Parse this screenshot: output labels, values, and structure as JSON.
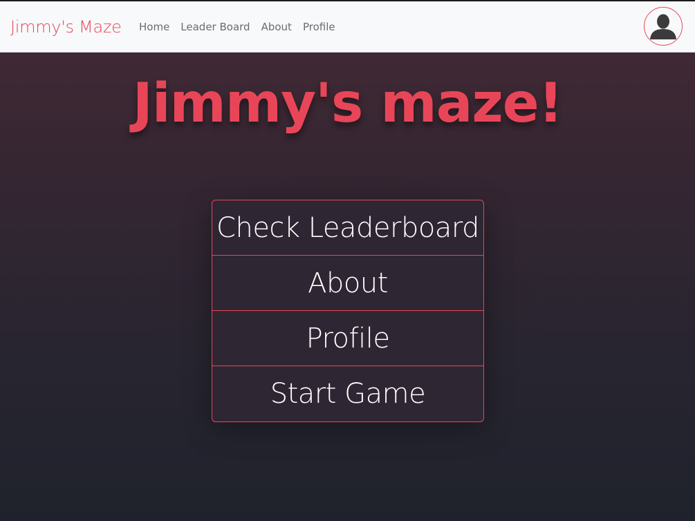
{
  "navbar": {
    "brand": "Jimmy's Maze",
    "links": [
      "Home",
      "Leader Board",
      "About",
      "Profile"
    ]
  },
  "avatar": {
    "icon": "user-avatar-icon"
  },
  "hero": {
    "title": "Jimmy's maze!"
  },
  "menu": {
    "items": [
      "Check Leaderboard",
      "About",
      "Profile",
      "Start Game"
    ]
  },
  "colors": {
    "accent": "#e84658",
    "navbar_bg": "#f8f9fa",
    "page_bg_top": "#442a35",
    "page_bg_bottom": "#1f222c"
  }
}
